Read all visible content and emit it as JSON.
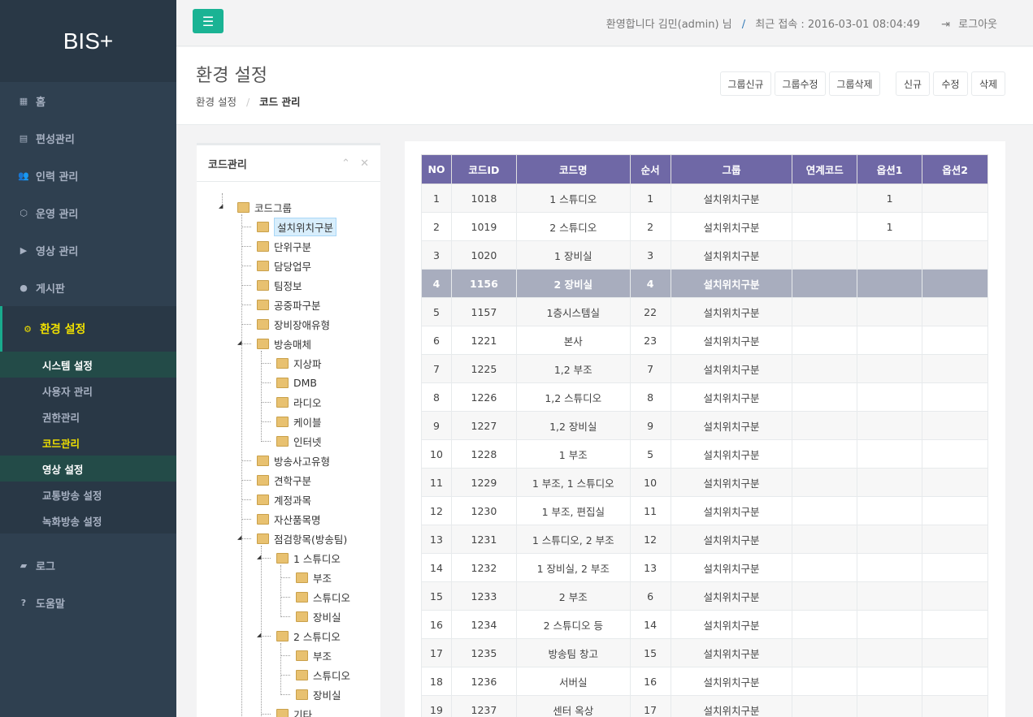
{
  "app": {
    "logo": "BIS+"
  },
  "sidebar": {
    "items": [
      {
        "label": "홈",
        "icon": "grid-icon",
        "glyph": "▦"
      },
      {
        "label": "편성관리",
        "icon": "calendar-icon",
        "glyph": "▤"
      },
      {
        "label": "인력 관리",
        "icon": "users-icon",
        "glyph": "👥"
      },
      {
        "label": "운영 관리",
        "icon": "cube-icon",
        "glyph": "⬡"
      },
      {
        "label": "영상 관리",
        "icon": "video-icon",
        "glyph": "▶"
      },
      {
        "label": "게시판",
        "icon": "comment-icon",
        "glyph": "●"
      }
    ],
    "active": {
      "label": "환경 설정",
      "icon": "cogs-icon",
      "glyph": "⚙"
    },
    "subitems": [
      {
        "label": "시스템 설정"
      },
      {
        "label": "사용자 관리"
      },
      {
        "label": "권한관리"
      },
      {
        "label": "코드관리"
      },
      {
        "label": "영상 설정"
      },
      {
        "label": "교통방송 설정"
      },
      {
        "label": "녹화방송 설정"
      }
    ],
    "bottom": [
      {
        "label": "로그",
        "icon": "book-icon",
        "glyph": "▰"
      },
      {
        "label": "도움말",
        "icon": "question-icon",
        "glyph": "?"
      }
    ]
  },
  "topbar": {
    "menu_glyph": "☰",
    "welcome": "환영합니다 김민(admin) 님",
    "separator": "/",
    "last_login": "최근 접속 : 2016-03-01 08:04:49",
    "logout_glyph": "⇥",
    "logout": "로그아웃"
  },
  "heading": {
    "title": "환경 설정",
    "breadcrumb": [
      "환경 설정",
      "코드 관리"
    ],
    "breadcrumb_sep": "/",
    "buttons": [
      "그룹신규",
      "그룹수정",
      "그룹삭제",
      "신규",
      "수정",
      "삭제"
    ]
  },
  "tree_panel": {
    "title": "코드관리",
    "collapse_glyph": "⌃",
    "close_glyph": "✕",
    "root": "코드그룹",
    "nodes": [
      "설치위치구분",
      "단위구분",
      "담당업무",
      "팀정보",
      "공중파구분",
      "장비장애유형",
      "방송매체",
      "지상파",
      "DMB",
      "라디오",
      "케이블",
      "인터넷",
      "방송사고유형",
      "견학구분",
      "계정과목",
      "자산품목명",
      "점검항목(방송팀)",
      "1 스튜디오",
      "부조",
      "스튜디오",
      "장비실",
      "2 스튜디오",
      "부조",
      "스튜디오",
      "장비실",
      "기타"
    ]
  },
  "table": {
    "headers": [
      "NO",
      "코드ID",
      "코드명",
      "순서",
      "그룹",
      "연계코드",
      "옵션1",
      "옵션2"
    ],
    "rows": [
      [
        "1",
        "1018",
        "1 스튜디오",
        "1",
        "설치위치구분",
        "",
        "1",
        ""
      ],
      [
        "2",
        "1019",
        "2 스튜디오",
        "2",
        "설치위치구분",
        "",
        "1",
        ""
      ],
      [
        "3",
        "1020",
        "1 장비실",
        "3",
        "설치위치구분",
        "",
        "",
        ""
      ],
      [
        "4",
        "1156",
        "2 장비실",
        "4",
        "설치위치구분",
        "",
        "",
        ""
      ],
      [
        "5",
        "1157",
        "1층시스템실",
        "22",
        "설치위치구분",
        "",
        "",
        ""
      ],
      [
        "6",
        "1221",
        "본사",
        "23",
        "설치위치구분",
        "",
        "",
        ""
      ],
      [
        "7",
        "1225",
        "1,2 부조",
        "7",
        "설치위치구분",
        "",
        "",
        ""
      ],
      [
        "8",
        "1226",
        "1,2 스튜디오",
        "8",
        "설치위치구분",
        "",
        "",
        ""
      ],
      [
        "9",
        "1227",
        "1,2 장비실",
        "9",
        "설치위치구분",
        "",
        "",
        ""
      ],
      [
        "10",
        "1228",
        "1 부조",
        "5",
        "설치위치구분",
        "",
        "",
        ""
      ],
      [
        "11",
        "1229",
        "1 부조, 1 스튜디오",
        "10",
        "설치위치구분",
        "",
        "",
        ""
      ],
      [
        "12",
        "1230",
        "1 부조, 편집실",
        "11",
        "설치위치구분",
        "",
        "",
        ""
      ],
      [
        "13",
        "1231",
        "1 스튜디오, 2 부조",
        "12",
        "설치위치구분",
        "",
        "",
        ""
      ],
      [
        "14",
        "1232",
        "1 장비실, 2 부조",
        "13",
        "설치위치구분",
        "",
        "",
        ""
      ],
      [
        "15",
        "1233",
        "2 부조",
        "6",
        "설치위치구분",
        "",
        "",
        ""
      ],
      [
        "16",
        "1234",
        "2 스튜디오 등",
        "14",
        "설치위치구분",
        "",
        "",
        ""
      ],
      [
        "17",
        "1235",
        "방송팀 창고",
        "15",
        "설치위치구분",
        "",
        "",
        ""
      ],
      [
        "18",
        "1236",
        "서버실",
        "16",
        "설치위치구분",
        "",
        "",
        ""
      ],
      [
        "19",
        "1237",
        "센터 옥상",
        "17",
        "설치위치구분",
        "",
        "",
        ""
      ]
    ]
  },
  "colors": {
    "accent": "#1ab394",
    "header": "#6f68a6",
    "sidebar": "#2f4050",
    "active_text": "#f0e000",
    "selected_row": "#a8adbe"
  }
}
